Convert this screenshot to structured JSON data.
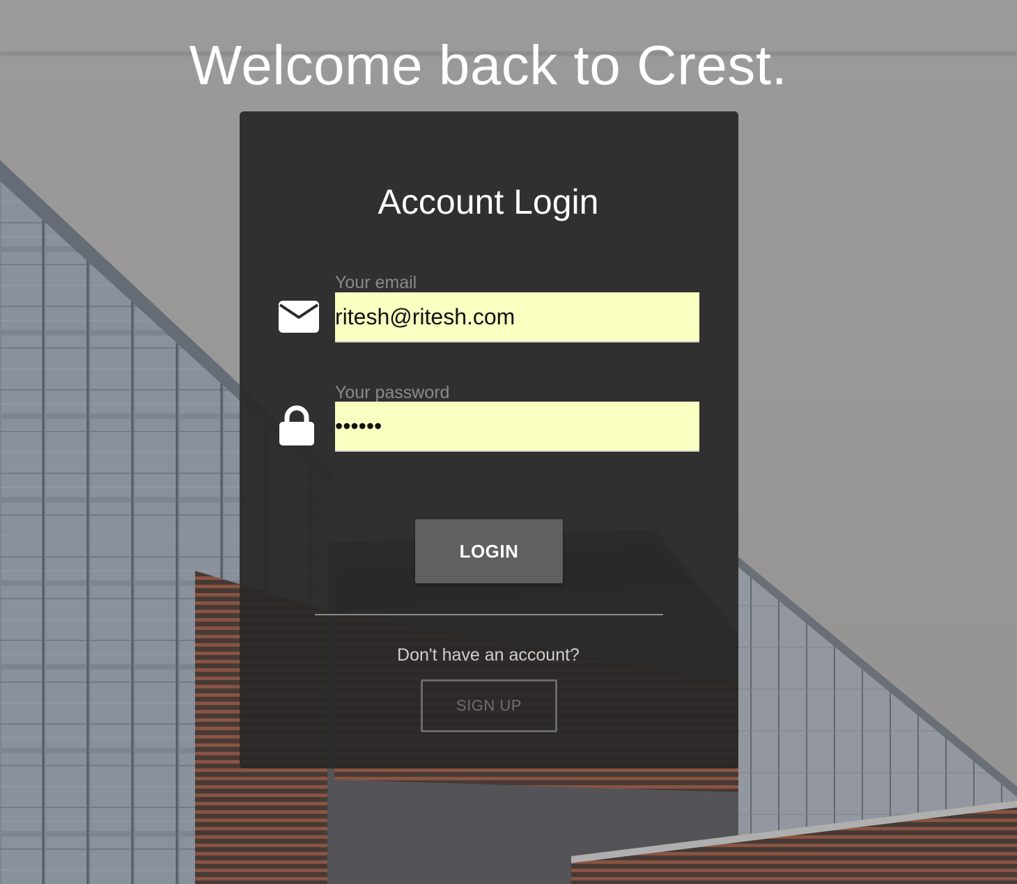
{
  "header": {
    "welcome_text": "Welcome back to Crest."
  },
  "login_card": {
    "title": "Account Login",
    "email": {
      "label": "Your email",
      "value": "ritesh@ritesh.com",
      "icon": "envelope-icon"
    },
    "password": {
      "label": "Your password",
      "value": "ritesh",
      "icon": "lock-icon"
    },
    "login_label": "LOGIN",
    "no_account_text": "Don't have an account?",
    "signup_label": "SIGN UP"
  },
  "colors": {
    "card_background": "#282828",
    "input_autofill": "#fafec0",
    "login_button": "#606060",
    "text_white": "#ffffff"
  }
}
